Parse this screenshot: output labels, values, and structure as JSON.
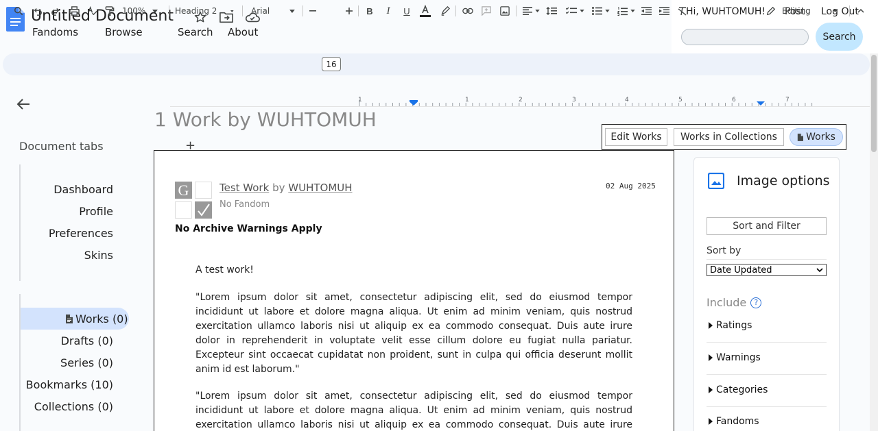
{
  "header": {
    "title": "Untitled Document",
    "nav": [
      "Fandoms",
      "Browse",
      "Search",
      "About"
    ],
    "greeting": "Hi, WUHTOMUH!",
    "post": "Post",
    "logout": "Log Out",
    "search_button": "Search",
    "search_placeholder": ""
  },
  "toolbar": {
    "zoom": "100%",
    "style": "Heading 2",
    "font": "Arial",
    "font_size": "16",
    "mode": "Editing"
  },
  "sidebar": {
    "title": "Document tabs",
    "account_items": [
      "Dashboard",
      "Profile",
      "Preferences",
      "Skins"
    ],
    "content_items": [
      "Works (0)",
      "Drafts (0)",
      "Series (0)",
      "Bookmarks (10)",
      "Collections (0)"
    ]
  },
  "ruler": {
    "labels": [
      "1",
      "1",
      "2",
      "3",
      "4",
      "5",
      "6",
      "7"
    ]
  },
  "main": {
    "heading": "1 Work by WUHTOMUH",
    "actions": [
      "Edit Works",
      "Works in Collections",
      "Works"
    ],
    "work": {
      "title": "Test Work",
      "by": "by",
      "author": "WUHTOMUH",
      "date": "02 Aug 2025",
      "fandom": "No Fandom",
      "warning": "No Archive Warnings Apply",
      "summary": "A test work!",
      "paragraphs": [
        "\"Lorem ipsum dolor sit amet, consectetur adipiscing elit, sed do eiusmod tempor incididunt ut labore et dolore magna aliqua. Ut enim ad minim veniam, quis nostrud exercitation ullamco laboris nisi ut aliquip ex ea commodo consequat. Duis aute irure dolor in reprehenderit in voluptate velit esse cillum dolore eu fugiat nulla pariatur. Excepteur sint occaecat cupidatat non proident, sunt in culpa qui officia deserunt mollit anim id est laborum.\"",
        "\"Lorem ipsum dolor sit amet, consectetur adipiscing elit, sed do eiusmod tempor incididunt ut labore et dolore magna aliqua. Ut enim ad minim veniam, quis nostrud exercitation ullamco laboris nisi ut aliquip ex ea commodo consequat. Duis aute irure dolor in"
      ]
    }
  },
  "image_panel": {
    "title": "Image options",
    "sort_filter": "Sort and Filter",
    "sort_by_label": "Sort by",
    "sort_by_value": "Date Updated",
    "include_label": "Include",
    "filters": [
      "Ratings",
      "Warnings",
      "Categories",
      "Fandoms"
    ]
  },
  "colors": {
    "accent": "#c2e7ff",
    "toolbar_bg": "#edf2fa",
    "selected_tab": "#d3e3fd",
    "doc_icon": "#4285f4"
  }
}
